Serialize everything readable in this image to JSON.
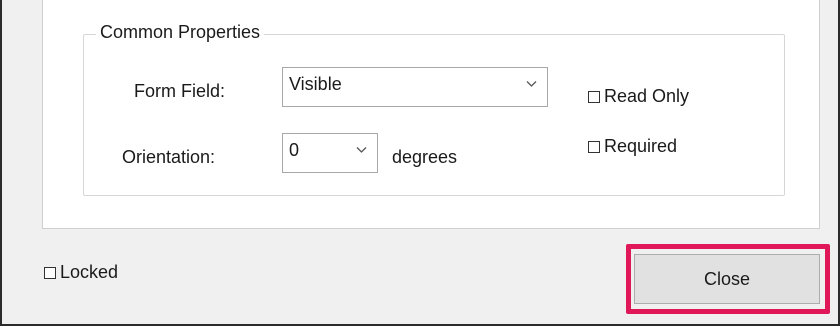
{
  "common_properties": {
    "title": "Common Properties",
    "form_field": {
      "label": "Form Field:",
      "value": "Visible"
    },
    "orientation": {
      "label": "Orientation:",
      "value": "0",
      "unit": "degrees"
    },
    "read_only": {
      "label": "Read Only",
      "checked": false
    },
    "required": {
      "label": "Required",
      "checked": false
    }
  },
  "footer": {
    "locked": {
      "label": "Locked",
      "checked": false
    },
    "close_label": "Close"
  },
  "colors": {
    "highlight": "#e0185a",
    "dialog_bg": "#f0f0f0",
    "button_bg": "#e1e1e1"
  }
}
